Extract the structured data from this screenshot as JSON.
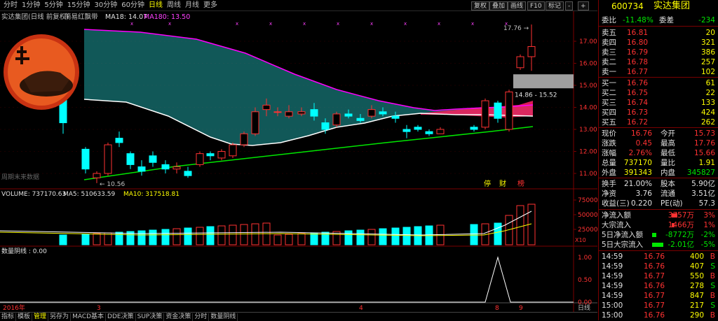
{
  "periods": [
    "分时",
    "1分钟",
    "5分钟",
    "15分钟",
    "30分钟",
    "60分钟",
    "日线",
    "周线",
    "月线",
    "更多"
  ],
  "active_period": "日线",
  "toolbar": [
    "复权",
    "叠加",
    "画线",
    "F10",
    "标记",
    "-",
    "+"
  ],
  "info_line": {
    "name": "实达集团(日线 前复权)",
    "indicator": "简易红飘带",
    "ma18_label": "MA18: 14.07",
    "ma180_label": "MA180: 13.50"
  },
  "watermark_text": "周期末来数据",
  "price_axis": [
    "17.00",
    "16.00",
    "15.00",
    "14.00",
    "13.00",
    "12.00",
    "11.00"
  ],
  "max_label": "17.76",
  "min_label": "10.56",
  "range_label": "14.86 - 15.52",
  "signal_labels": [
    "停",
    "财",
    "榜"
  ],
  "volume_line": {
    "volume": "VOLUME: 737170.63",
    "ma5": "MA5: 510633.59",
    "ma10": "MA10: 317518.81"
  },
  "volume_axis": [
    "75000",
    "50000",
    "25000"
  ],
  "volume_unit": "X10",
  "lower_indicator": "数量阴线 : 0.00",
  "lower_axis": [
    "1.00",
    "0.50",
    "0.00"
  ],
  "date_axis": [
    "2016年",
    "3",
    "4",
    "8",
    "9"
  ],
  "period_label": "日线",
  "bottom_tabs": [
    "指标",
    "模板",
    "管理",
    "另存为",
    "MACD基本",
    "DDE决策",
    "SUP决策",
    "资金决策",
    "分时",
    "数量阴线"
  ],
  "active_tab": "管理",
  "quote": {
    "code": "600734",
    "name": "实达集团",
    "ratio_label": "委比",
    "ratio": "-11.48%",
    "diff_label": "委差",
    "diff": "-234",
    "asks": [
      {
        "label": "卖五",
        "price": "16.81",
        "vol": "20"
      },
      {
        "label": "卖四",
        "price": "16.80",
        "vol": "321"
      },
      {
        "label": "卖三",
        "price": "16.79",
        "vol": "386"
      },
      {
        "label": "卖二",
        "price": "16.78",
        "vol": "257"
      },
      {
        "label": "卖一",
        "price": "16.77",
        "vol": "102"
      }
    ],
    "bids": [
      {
        "label": "买一",
        "price": "16.76",
        "vol": "61"
      },
      {
        "label": "买二",
        "price": "16.75",
        "vol": "22"
      },
      {
        "label": "买三",
        "price": "16.74",
        "vol": "133"
      },
      {
        "label": "买四",
        "price": "16.73",
        "vol": "424"
      },
      {
        "label": "买五",
        "price": "16.72",
        "vol": "262"
      }
    ],
    "stats": [
      {
        "l1": "现价",
        "v1": "16.76",
        "l2": "今开",
        "v2": "15.73"
      },
      {
        "l1": "涨跌",
        "v1": "0.45",
        "l2": "最高",
        "v2": "17.76"
      },
      {
        "l1": "涨幅",
        "v1": "2.76%",
        "l2": "最低",
        "v2": "15.66"
      },
      {
        "l1": "总量",
        "v1": "737170",
        "l2": "量比",
        "v2": "1.91"
      },
      {
        "l1": "外盘",
        "v1": "391343",
        "l2": "内盘",
        "v2": "345827"
      }
    ],
    "stats2": [
      {
        "l1": "换手",
        "v1": "21.00%",
        "l2": "股本",
        "v2": "5.90亿"
      },
      {
        "l1": "净资",
        "v1": "3.76",
        "l2": "流通",
        "v2": "3.51亿"
      },
      {
        "l1": "收益(三)",
        "v1": "0.220",
        "l2": "PE(动)",
        "v2": "57.3"
      }
    ],
    "flows": [
      {
        "label": "净流入额",
        "value": "3757万",
        "pct": "3%"
      },
      {
        "label": "大宗流入",
        "value": "1466万",
        "pct": "1%"
      },
      {
        "label": "5日净流入额",
        "value": "-8772万",
        "pct": "-2%"
      },
      {
        "label": "5日大宗流入",
        "value": "-2.01亿",
        "pct": "-5%"
      }
    ],
    "ticks": [
      {
        "time": "14:59",
        "price": "16.76",
        "vol": "400",
        "side": "B"
      },
      {
        "time": "14:59",
        "price": "16.76",
        "vol": "407",
        "side": "S"
      },
      {
        "time": "14:59",
        "price": "16.77",
        "vol": "550",
        "side": "B"
      },
      {
        "time": "14:59",
        "price": "16.76",
        "vol": "278",
        "side": "S"
      },
      {
        "time": "14:59",
        "price": "16.77",
        "vol": "847",
        "side": "B"
      },
      {
        "time": "15:00",
        "price": "16.77",
        "vol": "217",
        "side": "S"
      },
      {
        "time": "15:00",
        "price": "16.76",
        "vol": "290",
        "side": "B"
      }
    ]
  },
  "colors": {
    "up": "#ff3232",
    "down": "#00ffff",
    "ma_long": "#00e600",
    "ma_short": "#ff00ff",
    "band": "#1fa0a0",
    "bg": "#000000"
  }
}
